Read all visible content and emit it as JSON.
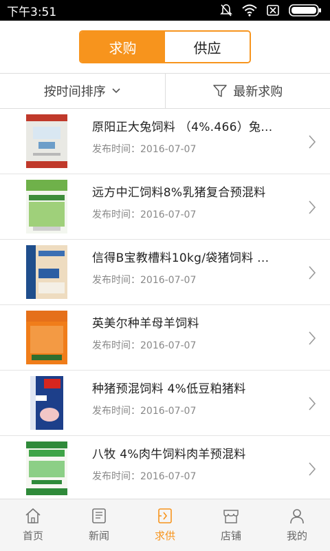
{
  "status_bar": {
    "time": "下午3:51"
  },
  "segment": {
    "tabs": [
      {
        "label": "求购"
      },
      {
        "label": "供应"
      }
    ]
  },
  "filters": {
    "sort_label": "按时间排序",
    "filter_label": "最新求购"
  },
  "list": [
    {
      "title": "原阳正大兔饲料 （4%.466）兔...",
      "date": "发布时间：2016-07-07"
    },
    {
      "title": "远方中汇饲料8%乳猪复合预混料",
      "date": "发布时间：2016-07-07"
    },
    {
      "title": "信得B宝教槽料10kg/袋猪饲料 ...",
      "date": "发布时间：2016-07-07"
    },
    {
      "title": "英美尔种羊母羊饲料",
      "date": "发布时间：2016-07-07"
    },
    {
      "title": "种猪预混饲料 4%低豆粕猪料",
      "date": "发布时间：2016-07-07"
    },
    {
      "title": "八牧 4%肉牛饲料肉羊预混料",
      "date": "发布时间：2016-07-07"
    }
  ],
  "tabbar": {
    "items": [
      {
        "label": "首页",
        "icon": "home-icon"
      },
      {
        "label": "新闻",
        "icon": "news-icon"
      },
      {
        "label": "求供",
        "icon": "supply-demand-icon"
      },
      {
        "label": "店铺",
        "icon": "store-icon"
      },
      {
        "label": "我的",
        "icon": "user-icon"
      }
    ]
  },
  "colors": {
    "accent": "#f7941d",
    "status_bar": "#000000"
  }
}
